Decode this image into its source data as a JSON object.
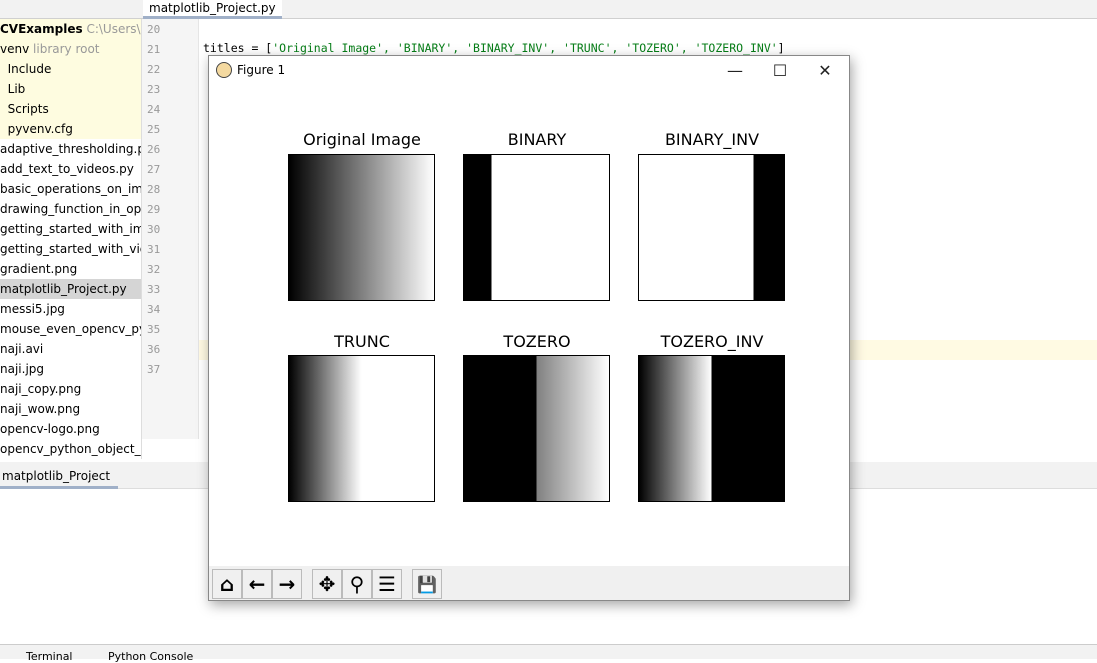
{
  "ide": {
    "tab": "matplotlib_Project.py",
    "tree": [
      {
        "label": "CVExamples",
        "hint": "C:\\Users\\naji"
      },
      {
        "label": "venv",
        "hint": "library root"
      },
      {
        "label": "Include"
      },
      {
        "label": "Lib"
      },
      {
        "label": "Scripts"
      },
      {
        "label": "pyvenv.cfg"
      },
      {
        "label": "adaptive_thresholding.py"
      },
      {
        "label": "add_text_to_videos.py"
      },
      {
        "label": "basic_operations_on_image.py"
      },
      {
        "label": "drawing_function_in_opencv"
      },
      {
        "label": "getting_started_with_image.py"
      },
      {
        "label": "getting_started_with_video.py"
      },
      {
        "label": "gradient.png"
      },
      {
        "label": "matplotlib_Project.py"
      },
      {
        "label": "messi5.jpg"
      },
      {
        "label": "mouse_even_opencv_python"
      },
      {
        "label": "naji.avi"
      },
      {
        "label": "naji.jpg"
      },
      {
        "label": "naji_copy.png"
      },
      {
        "label": "naji_wow.png"
      },
      {
        "label": "opencv-logo.png"
      },
      {
        "label": "opencv_python_object_dete"
      }
    ],
    "line_numbers": [
      "20",
      "21",
      "22",
      "23",
      "24",
      "25",
      "26",
      "27",
      "28",
      "29",
      "30",
      "31",
      "32",
      "33",
      "34",
      "35",
      "36",
      "37"
    ],
    "code_line21_prefix": "titles = [",
    "code_line21_strings": "'Original Image', 'BINARY', 'BINARY_INV', 'TRUNC', 'TOZERO', 'TOZERO_INV'",
    "code_line21_suffix": "]",
    "run_tab": "matplotlib_Project",
    "bottom_tabs": [
      "Terminal",
      "Python Console"
    ]
  },
  "figure": {
    "title": "Figure 1",
    "minimize": "—",
    "maximize": "☐",
    "close": "✕",
    "plots": [
      {
        "title": "Original Image"
      },
      {
        "title": "BINARY"
      },
      {
        "title": "BINARY_INV"
      },
      {
        "title": "TRUNC"
      },
      {
        "title": "TOZERO"
      },
      {
        "title": "TOZERO_INV"
      }
    ],
    "toolbar": {
      "home": "⌂",
      "back": "←",
      "forward": "→",
      "pan": "✥",
      "zoom": "⚲",
      "configure": "☰",
      "save": "💾"
    }
  }
}
